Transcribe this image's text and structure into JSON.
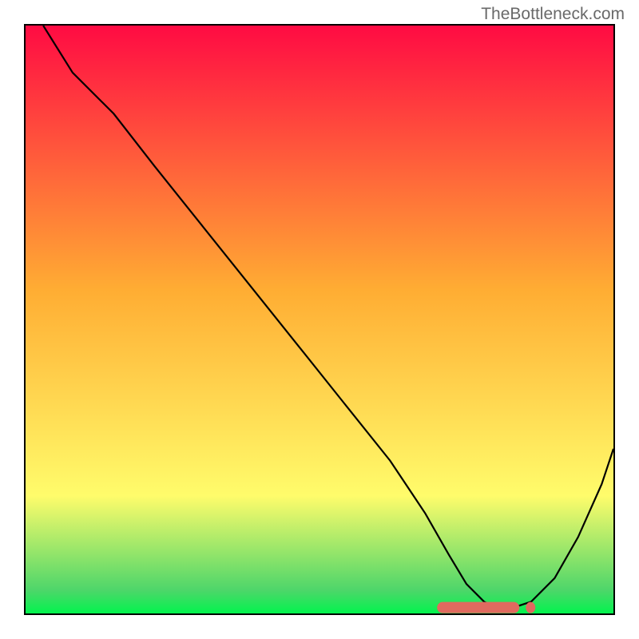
{
  "watermark": "TheBottleneck.com",
  "chart_data": {
    "type": "line",
    "title": "",
    "xlabel": "",
    "ylabel": "",
    "xlim": [
      0,
      100
    ],
    "ylim": [
      0,
      100
    ],
    "series": [
      {
        "name": "bottleneck-curve",
        "x": [
          3,
          8,
          15,
          22,
          30,
          38,
          46,
          54,
          62,
          68,
          72,
          75,
          78,
          80,
          83,
          86,
          90,
          94,
          98,
          100
        ],
        "values": [
          100,
          92,
          85,
          76,
          66,
          56,
          46,
          36,
          26,
          17,
          10,
          5,
          2,
          1,
          1,
          2,
          6,
          13,
          22,
          28
        ]
      }
    ],
    "markers": {
      "name": "recommended-range",
      "shape": "pill",
      "x_start": 70,
      "x_end": 84,
      "y": 1,
      "color": "#e06a5f"
    },
    "gradient_colors": {
      "top": "#ff0b43",
      "mid_upper": "#ffad33",
      "mid_lower": "#fffc6b",
      "bottom_green": "#4ed66a",
      "bottom_band": "#03f34e"
    }
  }
}
